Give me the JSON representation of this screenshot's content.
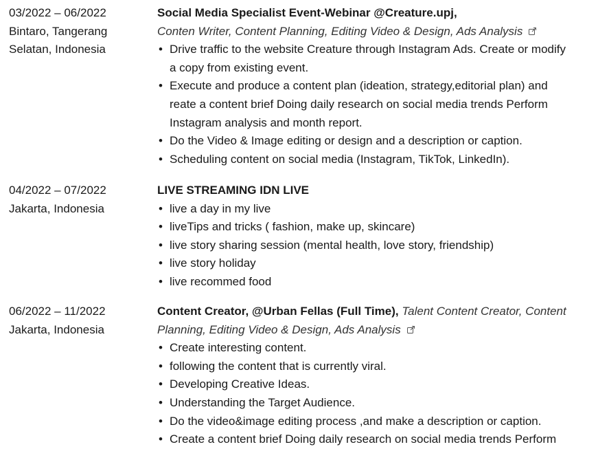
{
  "entries": [
    {
      "dates": "03/2022 – 06/2022",
      "location_lines": [
        "Bintaro, Tangerang",
        "Selatan, Indonesia"
      ],
      "title": "Social Media Specialist Event-Webinar @Creature.upj,",
      "subtitle": "Conten Writer, Content Planning, Editing Video & Design, Ads Analysis",
      "bullets": [
        [
          "Drive traffic to the website Creature through Instagram Ads. Create or modify",
          "a copy from existing event."
        ],
        [
          "Execute and produce a content plan (ideation, strategy,editorial plan) and",
          "reate a content brief Doing daily research on social media trends Perform",
          "Instagram analysis and month report."
        ],
        [
          "Do the Video & Image editing or design and a description or caption."
        ],
        [
          "Scheduling content on social media (Instagram, TikTok, LinkedIn)."
        ]
      ]
    },
    {
      "dates": "04/2022 – 07/2022",
      "location_lines": [
        "Jakarta, Indonesia"
      ],
      "title": "LIVE STREAMING IDN LIVE",
      "bullets": [
        [
          "live a day in my live"
        ],
        [
          "liveTips and tricks ( fashion, make up, skincare)"
        ],
        [
          "live story sharing session (mental health, love story, friendship)"
        ],
        [
          "live story holiday"
        ],
        [
          "live recommed food"
        ]
      ]
    },
    {
      "dates": "06/2022 – 11/2022",
      "location_lines": [
        "Jakarta, Indonesia"
      ],
      "title": "Content Creator, @Urban Fellas (Full Time),",
      "subtitle_inline": "Talent Content Creator, Content",
      "subtitle_line2": "Planning, Editing Video & Design, Ads Analysis",
      "bullets": [
        [
          "Create interesting content."
        ],
        [
          "following the content that is currently viral."
        ],
        [
          "Developing Creative Ideas."
        ],
        [
          "Understanding the Target Audience."
        ],
        [
          "Do the video&image editing process ,and make a description or caption."
        ],
        [
          "Create a content brief Doing daily research on social media trends Perform"
        ]
      ]
    }
  ],
  "icons": {
    "external_link": "external-link-icon"
  },
  "colors": {
    "text": "#1a1a1a",
    "subtitle": "#333333",
    "icon": "#555555"
  }
}
